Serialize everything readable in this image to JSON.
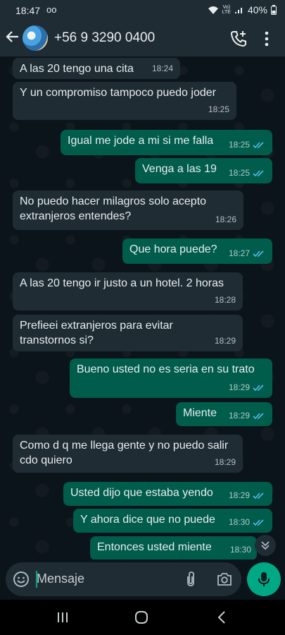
{
  "status_bar": {
    "time": "18:47",
    "voicemail": "oo",
    "network_top": "Vo)",
    "network_bottom": "LTE",
    "battery": "40%"
  },
  "header": {
    "contact": "+56 9 3290 0400"
  },
  "messages": [
    {
      "text": "A las 20 tengo una cita",
      "time": "18:24"
    },
    {
      "text": "Y un compromiso tampoco puedo joder",
      "time": "18:25"
    },
    {
      "text": "Igual me jode a mi si me falla",
      "time": "18:25"
    },
    {
      "text": "Venga a las 19",
      "time": "18:25"
    },
    {
      "text": "No puedo hacer milagros solo acepto extranjeros entendes?",
      "time": "18:26"
    },
    {
      "text": "Que hora puede?",
      "time": "18:27"
    },
    {
      "text": "A las 20 tengo ir justo a un hotel. 2 horas",
      "time": "18:28"
    },
    {
      "text": "Prefieei extranjeros para evitar transtornos si?",
      "time": "18:29"
    },
    {
      "text": "Bueno usted no es seria en su trato",
      "time": "18:29"
    },
    {
      "text": "Miente",
      "time": "18:29"
    },
    {
      "text": "Como d q me llega gente y no puedo salir cdo quiero",
      "time": "18:29"
    },
    {
      "text": "Usted dijo que estaba yendo",
      "time": "18:29"
    },
    {
      "text": "Y ahora dice que no puede",
      "time": "18:30"
    },
    {
      "text": "Entonces usted miente",
      "time": "18:30"
    }
  ],
  "composer": {
    "placeholder": "Mensaje"
  },
  "colors": {
    "incoming": "#1f2c34",
    "outgoing": "#005c4b",
    "accent": "#00a884",
    "read_ticks": "#53bdeb"
  }
}
